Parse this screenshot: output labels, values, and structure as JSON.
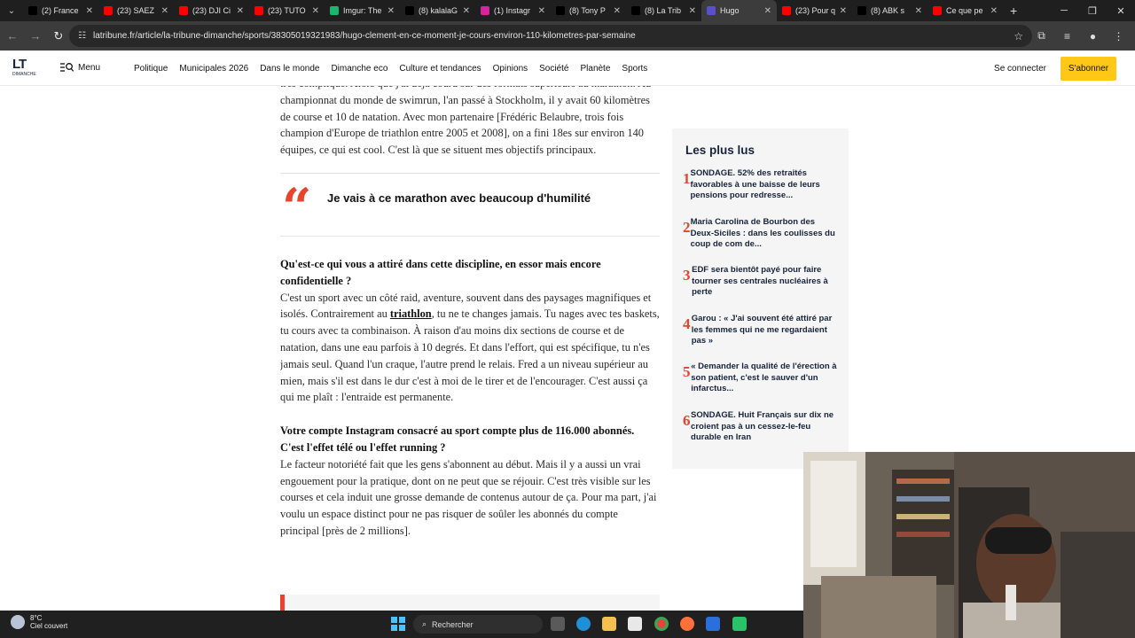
{
  "browser": {
    "tabs": [
      {
        "label": "(2) France",
        "icon": "x-icon",
        "color": "#000000"
      },
      {
        "label": "(23) SAEZ",
        "icon": "youtube-icon",
        "color": "#ff0000"
      },
      {
        "label": "(23) DJI Ci",
        "icon": "youtube-icon",
        "color": "#ff0000"
      },
      {
        "label": "(23) TUTO",
        "icon": "youtube-icon",
        "color": "#ff0000"
      },
      {
        "label": "Imgur: The",
        "icon": "imgur-icon",
        "color": "#1bb76e"
      },
      {
        "label": "(8) kalalaG",
        "icon": "x-icon",
        "color": "#000000"
      },
      {
        "label": "(1) Instagr",
        "icon": "instagram-icon",
        "color": "#d6249f"
      },
      {
        "label": "(8) Tony P",
        "icon": "x-icon",
        "color": "#000000"
      },
      {
        "label": "(8) La Trib",
        "icon": "x-icon",
        "color": "#000000"
      },
      {
        "label": "Hugo",
        "icon": "latribune-icon",
        "color": "#5a4fcf",
        "active": true
      },
      {
        "label": "(23) Pour q",
        "icon": "youtube-icon",
        "color": "#ff0000"
      },
      {
        "label": "(8) ABK s",
        "icon": "x-icon",
        "color": "#000000"
      },
      {
        "label": "Ce que pe",
        "icon": "youtube-icon",
        "color": "#ff0000"
      }
    ],
    "url": "latribune.fr/article/la-tribune-dimanche/sports/38305019321983/hugo-clement-en-ce-moment-je-cours-environ-110-kilometres-par-semaine"
  },
  "site": {
    "logo": "LT",
    "logo_sub": "DIMANCHE",
    "menu_label": "Menu",
    "nav": [
      "Politique",
      "Municipales 2026",
      "Dans le monde",
      "Dimanche eco",
      "Culture et tendances",
      "Opinions",
      "Société",
      "Planète",
      "Sports"
    ],
    "login": "Se connecter",
    "subscribe": "S'abonner"
  },
  "article": {
    "p1": "très compliqué. Alors que j'ai déjà couru sur des formats supérieurs au marathon. Au championnat du monde de swimrun, l'an passé à Stockholm, il y avait 60 kilomètres de course et 10 de natation. Avec mon partenaire [Frédéric Belaubre, trois fois champion d'Europe de triathlon entre 2005 et 2008], on a fini 18es sur environ 140 équipes, ce qui est cool. C'est là que se situent mes objectifs principaux.",
    "quote_mark": "“",
    "quote": "Je vais à ce marathon avec beaucoup d'humilité",
    "q1": "Qu'est-ce qui vous a attiré dans cette discipline, en essor mais encore confidentielle ?",
    "a1_before": "C'est un sport avec un côté raid, aventure, souvent dans des paysages magnifiques et isolés. Contrairement au ",
    "a1_link": "triathlon",
    "a1_after": ", tu ne te changes jamais. Tu nages avec tes baskets, tu cours avec ta combinaison. À raison d'au moins dix sections de course et de natation, dans une eau parfois à 10 degrés. Et dans l'effort, qui est spécifique, tu n'es jamais seul. Quand l'un craque, l'autre prend le relais. Fred a un niveau supérieur au mien, mais s'il est dans le dur c'est à moi de le tirer et de l'encourager. C'est aussi ça qui me plaît : l'entraide est permanente.",
    "q2": "Votre compte Instagram consacré au sport compte plus de 116.000 abonnés. C'est l'effet télé ou l'effet running ?",
    "a2": "Le facteur notoriété fait que les gens s'abonnent au début. Mais il y a aussi un vrai engouement pour la pratique, dont on ne peut que se réjouir. C'est très visible sur les courses et cela induit une grosse demande de contenus autour de ça. Pour ma part, j'ai voulu un espace distinct pour ne pas risquer de soûler les abonnés du compte principal [près de 2 millions]."
  },
  "sidebar": {
    "title": "Les plus lus",
    "items": [
      {
        "num": "1",
        "text": "SONDAGE. 52% des retraités favorables à une baisse de leurs pensions pour redresse..."
      },
      {
        "num": "2",
        "text": "Maria Carolina de Bourbon des Deux-Siciles : dans les coulisses du coup de com de..."
      },
      {
        "num": "3",
        "text": "EDF sera bientôt payé pour faire tourner ses centrales nucléaires à perte"
      },
      {
        "num": "4",
        "text": "Garou : « J'ai souvent été attiré par les femmes qui ne me regardaient pas »"
      },
      {
        "num": "5",
        "text": "« Demander la qualité de l'érection à son patient, c'est le sauver d'un infarctus..."
      },
      {
        "num": "6",
        "text": "SONDAGE. Huit Français sur dix ne croient pas à un cessez-le-feu durable en Iran"
      }
    ]
  },
  "taskbar": {
    "temperature": "8°C",
    "weather": "Ciel couvert",
    "search_placeholder": "Rechercher"
  },
  "colors": {
    "accent_red": "#e8442b",
    "subscribe_yellow": "#ffc816",
    "navy": "#16233a"
  }
}
